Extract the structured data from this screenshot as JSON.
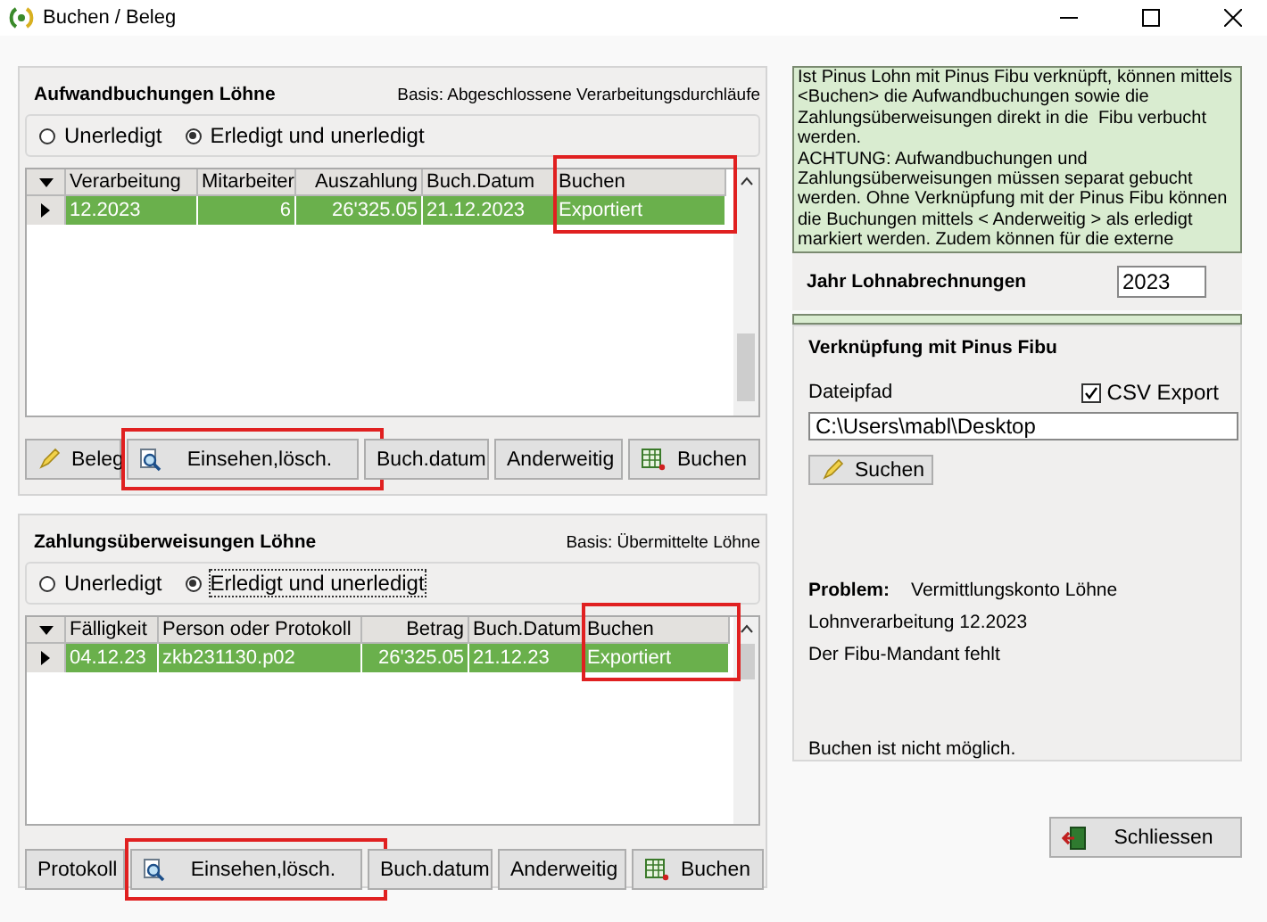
{
  "window": {
    "title": "Buchen / Beleg"
  },
  "sections": [
    {
      "title": "Aufwandbuchungen Löhne",
      "basis": "Basis: Abgeschlossene Verarbeitungsdurchläufe",
      "radios": [
        {
          "label": "Unerledigt",
          "selected": false
        },
        {
          "label": "Erledigt und unerledigt",
          "selected": true
        }
      ],
      "table": {
        "columns": [
          {
            "label": "Verarbeitung",
            "highlighted": false
          },
          {
            "label": "Mitarbeiter",
            "highlighted": false
          },
          {
            "label": "Auszahlung",
            "highlighted": false
          },
          {
            "label": "Buch.Datum",
            "highlighted": false
          },
          {
            "label": "Buchen",
            "highlighted": true
          }
        ],
        "rows": [
          {
            "selected": true,
            "cells": [
              "12.2023",
              "6",
              "26'325.05",
              "21.12.2023",
              "Exportiert"
            ]
          }
        ]
      },
      "buttons": [
        {
          "label": "Beleg",
          "highlighted": false
        },
        {
          "label": "Einsehen,lösch.",
          "highlighted": true
        },
        {
          "label": "Buch.datum",
          "highlighted": false
        },
        {
          "label": "Anderweitig",
          "highlighted": false
        },
        {
          "label": "Buchen",
          "highlighted": false
        }
      ]
    },
    {
      "title": "Zahlungsüberweisungen Löhne",
      "basis": "Basis: Übermittelte Löhne",
      "radios": [
        {
          "label": "Unerledigt",
          "selected": false
        },
        {
          "label": "Erledigt und unerledigt",
          "selected": true
        }
      ],
      "table": {
        "columns": [
          {
            "label": "Fälligkeit",
            "highlighted": false
          },
          {
            "label": "Person oder Protokoll",
            "highlighted": false
          },
          {
            "label": "Betrag",
            "highlighted": false
          },
          {
            "label": "Buch.Datum",
            "highlighted": false
          },
          {
            "label": "Buchen",
            "highlighted": true
          }
        ],
        "rows": [
          {
            "selected": true,
            "cells": [
              "04.12.23",
              "zkb231130.p02",
              "26'325.05",
              "21.12.23",
              "Exportiert"
            ]
          }
        ]
      },
      "buttons": [
        {
          "label": "Protokoll",
          "highlighted": false
        },
        {
          "label": "Einsehen,lösch.",
          "highlighted": true
        },
        {
          "label": "Buch.datum",
          "highlighted": false
        },
        {
          "label": "Anderweitig",
          "highlighted": false
        },
        {
          "label": "Buchen",
          "highlighted": false
        }
      ]
    }
  ],
  "info": {
    "text": "Ist Pinus Lohn mit Pinus Fibu verknüpft, können mittels <Buchen> die Aufwandbuchungen sowie die Zahlungsüberweisungen direkt in die  Fibu verbucht werden.\nACHTUNG: Aufwandbuchungen und Zahlungsüberweisungen müssen separat gebucht werden. Ohne Verknüpfung mit der Pinus Fibu können die Buchungen mittels < Anderweitig > als erledigt markiert werden. Zudem können für die externe"
  },
  "year": {
    "label": "Jahr Lohnabrechnungen",
    "value": "2023"
  },
  "link": {
    "title": "Verknüpfung mit Pinus Fibu",
    "path_label": "Dateipfad",
    "csv": {
      "label": "CSV Export",
      "checked": true
    },
    "path_value": "C:\\Users\\mabl\\Desktop",
    "search_button": "Suchen"
  },
  "problem": {
    "label": "Problem:",
    "detail": "Vermittlungskonto Löhne",
    "lines": [
      "Lohnverarbeitung 12.2023",
      "Der Fibu-Mandant fehlt"
    ],
    "result": "Buchen ist nicht möglich."
  },
  "close_button": "Schliessen"
}
